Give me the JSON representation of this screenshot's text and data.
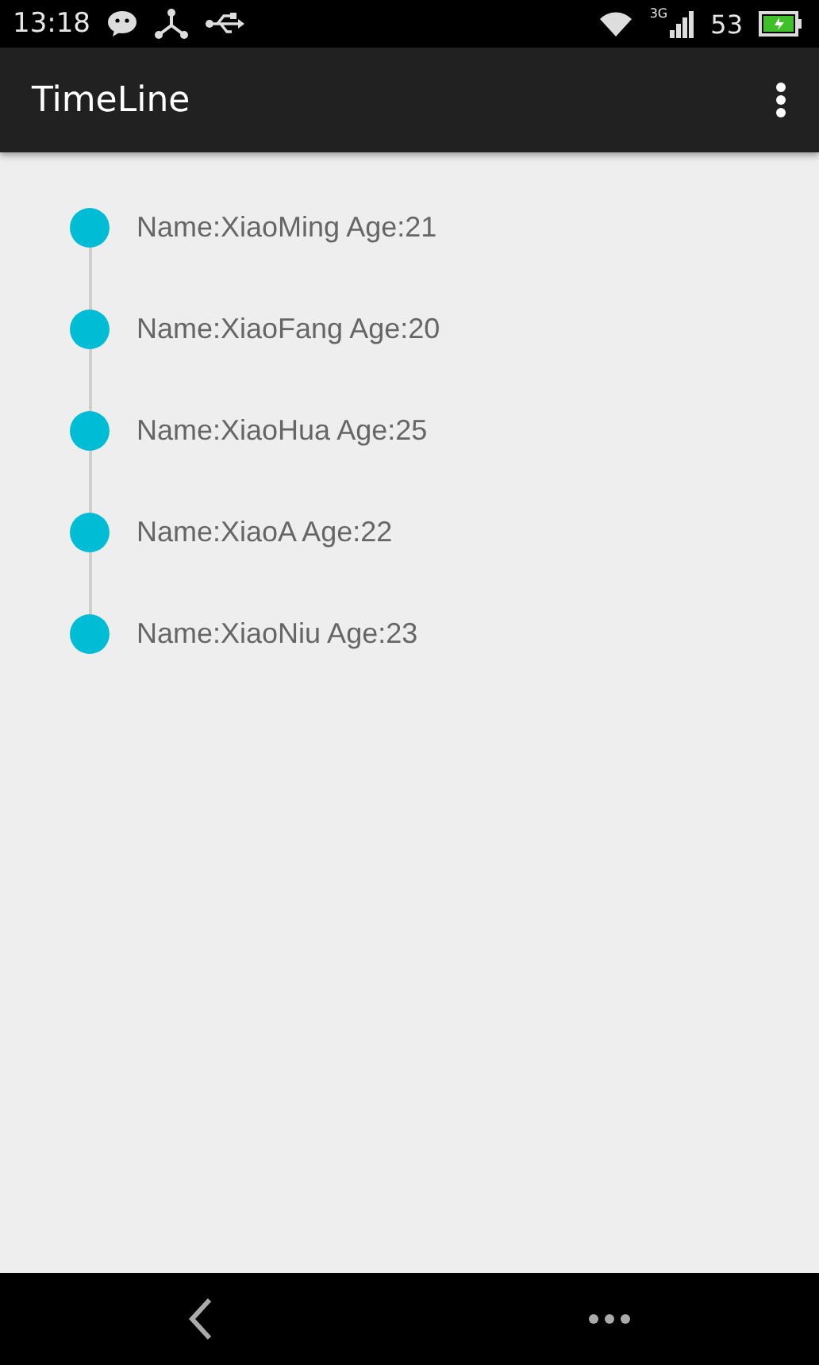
{
  "status_bar": {
    "time": "13:18",
    "network": "3G",
    "battery": "53"
  },
  "app_bar": {
    "title": "TimeLine"
  },
  "timeline": [
    {
      "text": "Name:XiaoMing Age:21"
    },
    {
      "text": "Name:XiaoFang Age:20"
    },
    {
      "text": "Name:XiaoHua Age:25"
    },
    {
      "text": "Name:XiaoA Age:22"
    },
    {
      "text": "Name:XiaoNiu Age:23"
    }
  ]
}
